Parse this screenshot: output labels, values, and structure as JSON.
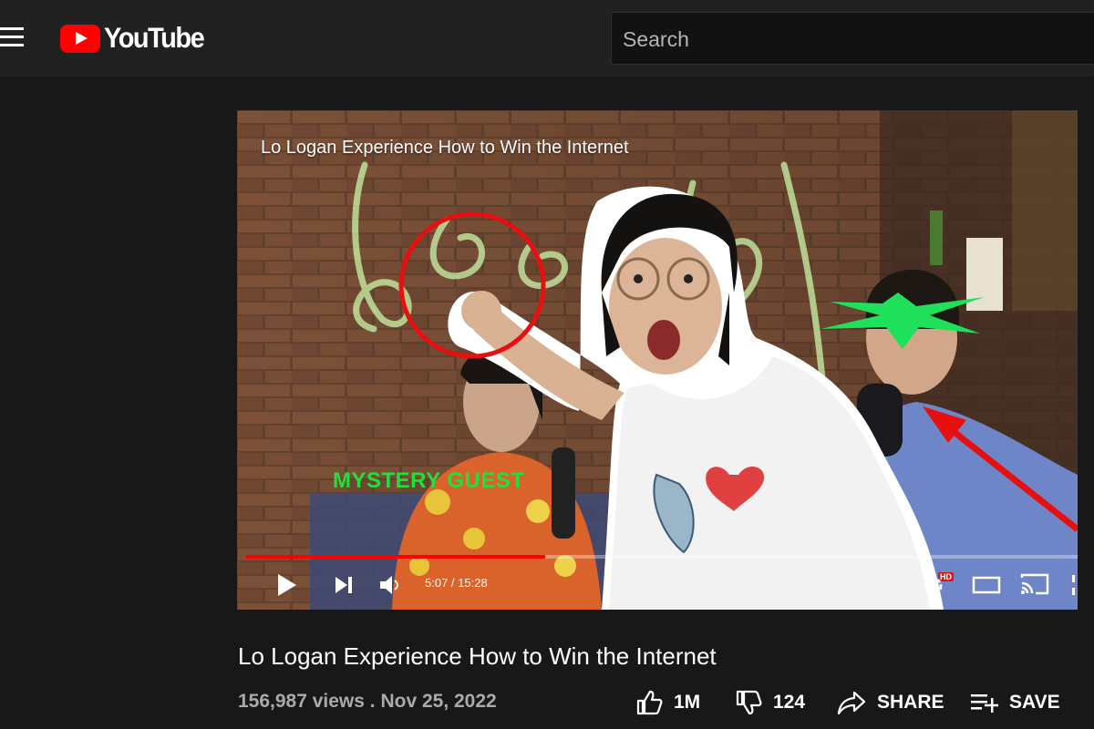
{
  "header": {
    "logo_text": "YouTube",
    "search_placeholder": "Search"
  },
  "player": {
    "overlay_title": "Lo Logan Experience How to Win the Internet",
    "thumbnail_caption": "MYSTERY GUEST",
    "time_display": "5:07 / 15:28",
    "progress_fraction": 0.36,
    "hd_badge": "HD"
  },
  "video": {
    "title": "Lo Logan Experience How to Win the Internet",
    "meta": "156,987 views . Nov 25, 2022"
  },
  "actions": {
    "like_count": "1M",
    "dislike_count": "124",
    "share_label": "SHARE",
    "save_label": "SAVE"
  },
  "colors": {
    "accent": "#ff0000",
    "background": "#181818",
    "topbar": "#212121",
    "caption_green": "#22e03a"
  },
  "icons": [
    "menu-icon",
    "youtube-logo-icon",
    "play-icon",
    "next-icon",
    "volume-icon",
    "settings-icon",
    "theater-icon",
    "cast-icon",
    "like-icon",
    "dislike-icon",
    "share-icon",
    "save-icon"
  ]
}
